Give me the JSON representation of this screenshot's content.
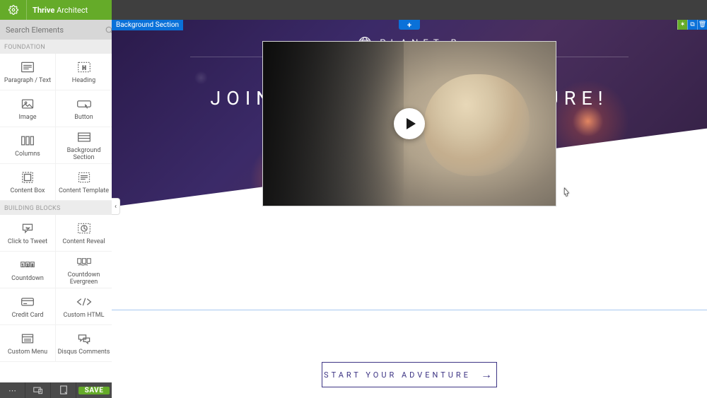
{
  "app": {
    "brand_prefix": "Thrive ",
    "brand_suffix": "Architect"
  },
  "search": {
    "placeholder": "Search Elements"
  },
  "groups": {
    "foundation": {
      "title": "FOUNDATION"
    },
    "building_blocks": {
      "title": "BUILDING BLOCKS"
    }
  },
  "elements": {
    "foundation": [
      {
        "label": "Paragraph / Text"
      },
      {
        "label": "Heading"
      },
      {
        "label": "Image"
      },
      {
        "label": "Button"
      },
      {
        "label": "Columns"
      },
      {
        "label": "Background Section"
      },
      {
        "label": "Content Box"
      },
      {
        "label": "Content Template"
      }
    ],
    "building_blocks": [
      {
        "label": "Click to Tweet"
      },
      {
        "label": "Content Reveal"
      },
      {
        "label": "Countdown"
      },
      {
        "label": "Countdown Evergreen"
      },
      {
        "label": "Credit Card"
      },
      {
        "label": "Custom HTML"
      },
      {
        "label": "Custom Menu"
      },
      {
        "label": "Disqus Comments"
      }
    ]
  },
  "bottom": {
    "save": "SAVE"
  },
  "canvas": {
    "selected_label": "Background Section",
    "add_symbol": "+",
    "logo_text": "PLANET B",
    "headline": "JOIN THE FINAL ADVENTURE!",
    "cta_label": "START YOUR ADVENTURE",
    "cta_arrow": "→"
  },
  "colors": {
    "brand_green": "#65ab29",
    "editor_blue": "#0a71d9",
    "cta_border": "#3d3484"
  }
}
